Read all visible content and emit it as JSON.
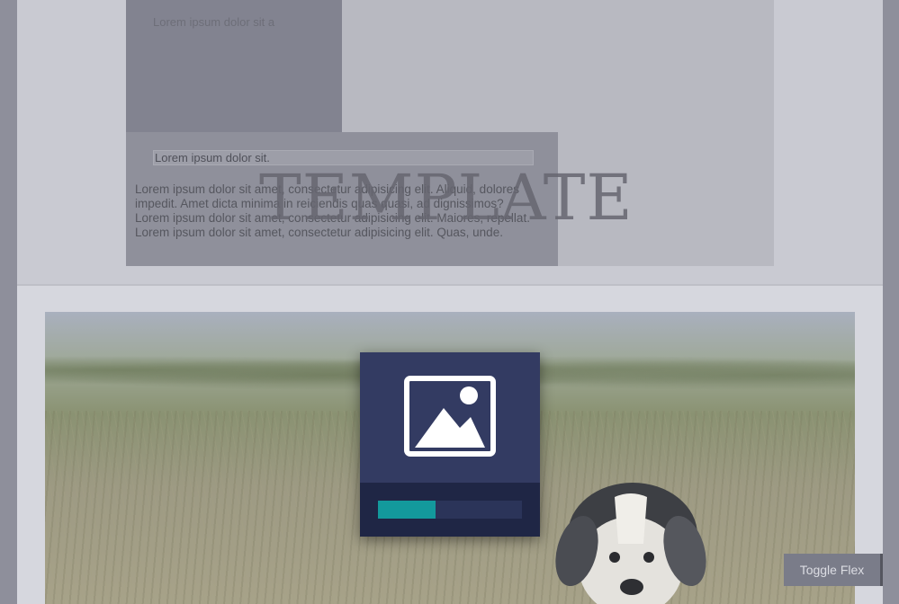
{
  "header": {
    "dark_box_text": "Lorem ipsum dolor sit a",
    "text_box_label": "Lorem ipsum dolor sit.",
    "paragraph_lines": [
      "Lorem ipsum dolor sit amet, consectetur adipisicing elit. Aliquid, dolores",
      "impedit. Amet dicta minima in reiciendis quas quasi, ad dignissimos?",
      "Lorem ipsum dolor sit amet, consectetur adipisicing elit. Maiores, repellat.",
      "Lorem ipsum dolor sit amet, consectetur adipisicing elit. Quas, unde."
    ],
    "watermark": "TEMPLATE"
  },
  "loader": {
    "icon": "image-icon",
    "progress_fraction": 0.4,
    "colors": {
      "panel": "#333b62",
      "footer": "#1f2645",
      "track": "#2b3459",
      "fill": "#13999c"
    }
  },
  "toggle": {
    "label": "Toggle Flex"
  }
}
